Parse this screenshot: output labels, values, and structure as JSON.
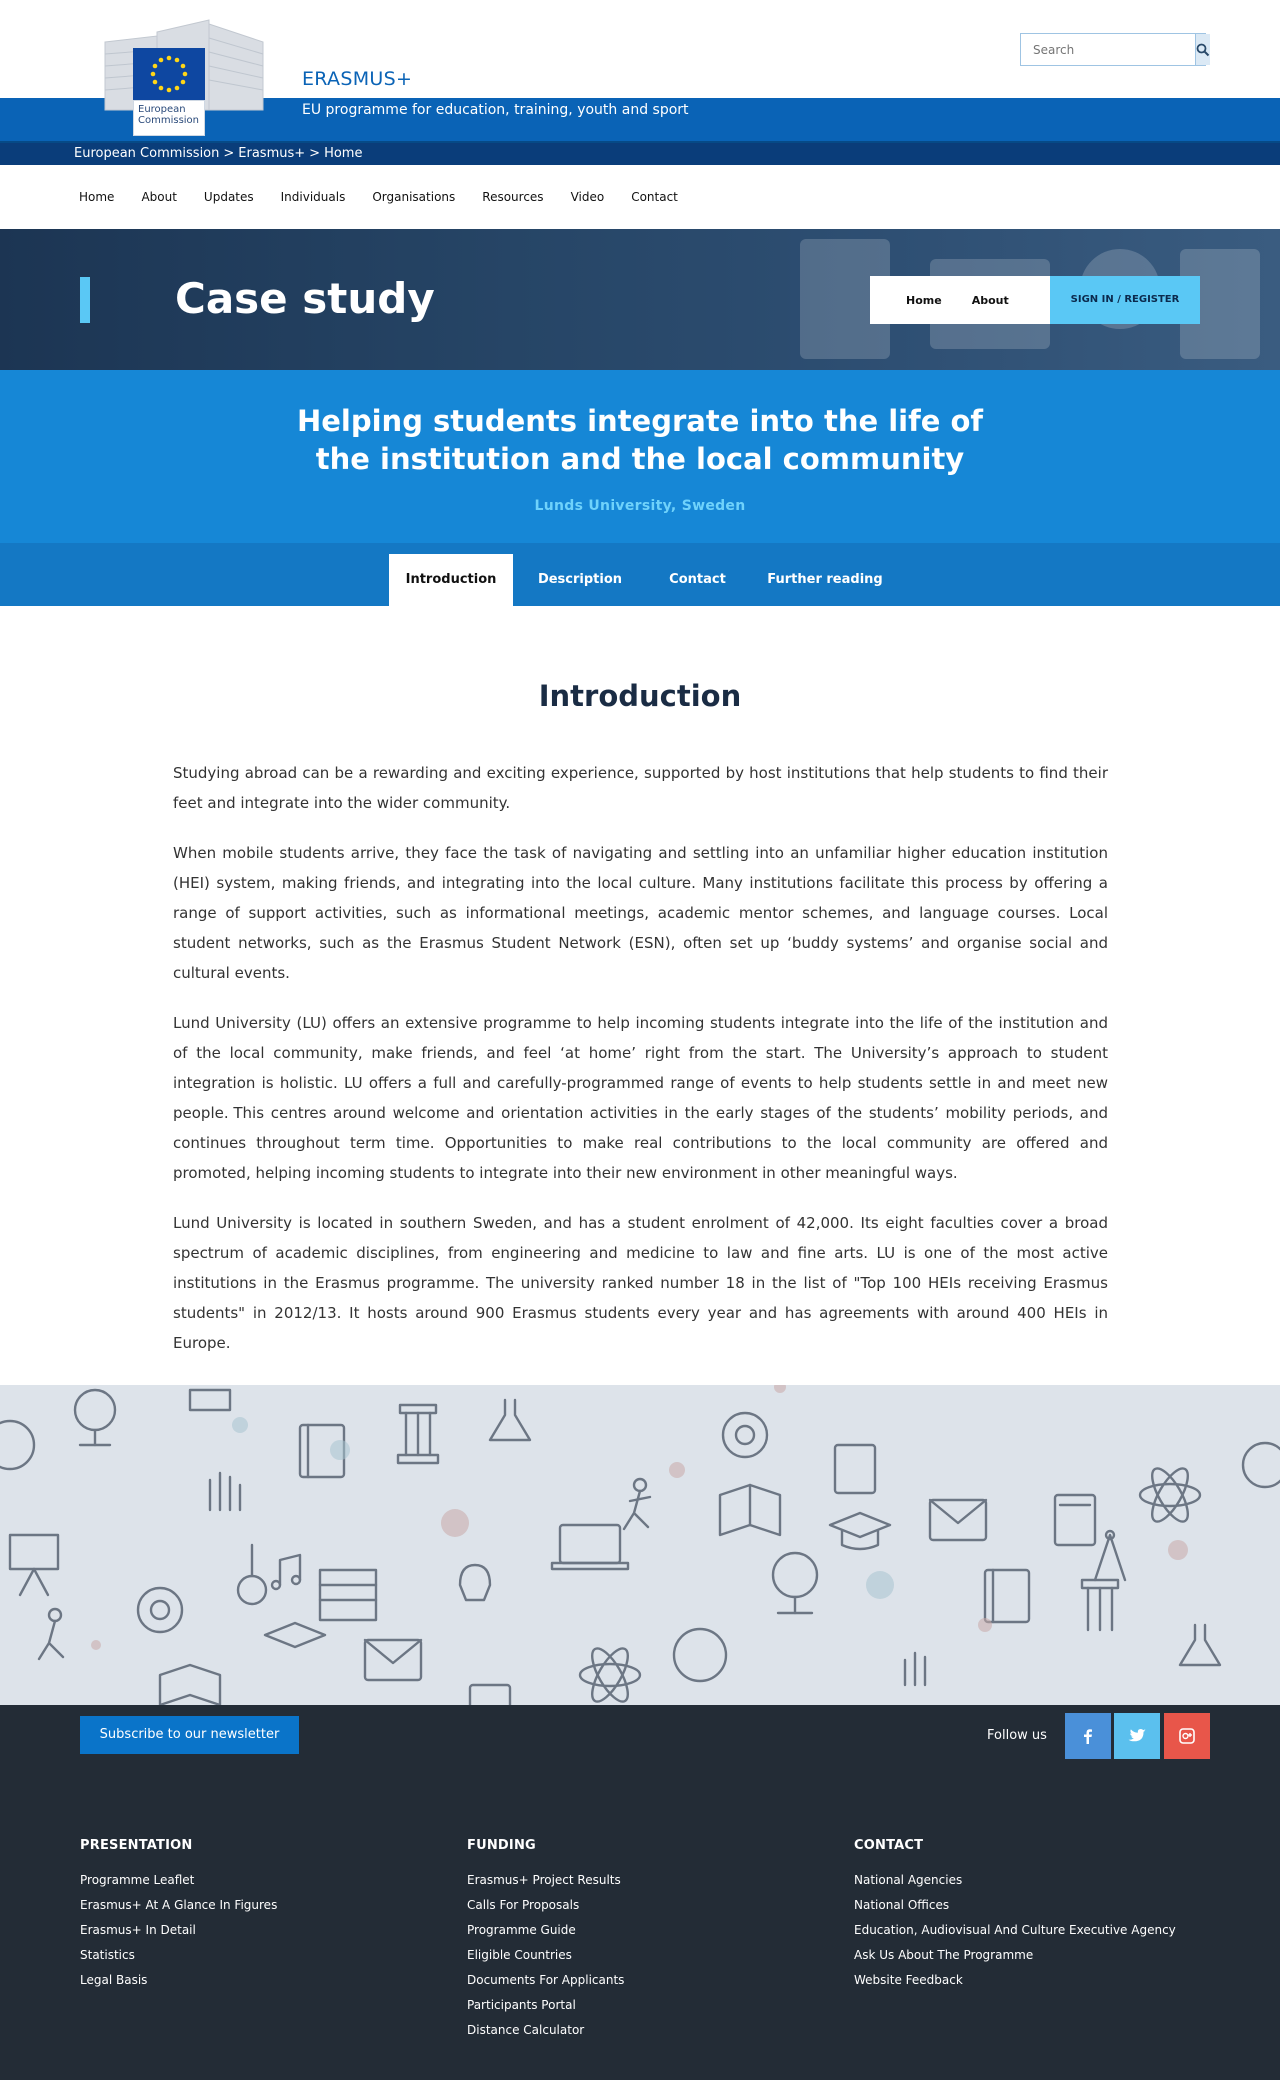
{
  "header": {
    "logo_text": "European Commission",
    "brand": "ERASMUS+",
    "tagline": "EU programme for education, training, youth and sport",
    "search_placeholder": "Search"
  },
  "breadcrumb": {
    "items": [
      "European Commission",
      "Erasmus+",
      "Home"
    ],
    "separator": ">"
  },
  "nav": {
    "items": [
      "Home",
      "About",
      "Updates",
      "Individuals",
      "Organisations",
      "Resources",
      "Video",
      "Contact"
    ]
  },
  "hero": {
    "title": "Case study",
    "box_links": [
      "Home",
      "About"
    ],
    "signin": "SIGN IN / REGISTER"
  },
  "case": {
    "title_line1": "Helping students integrate into the life of",
    "title_line2": "the institution and the local community",
    "subtitle": "Lunds University, Sweden"
  },
  "tabs": {
    "items": [
      "Introduction",
      "Description",
      "Contact",
      "Further reading"
    ],
    "active": "Introduction"
  },
  "content": {
    "heading": "Introduction",
    "paragraphs": [
      "Studying abroad can be a rewarding and exciting experience, supported by host institutions that help students to find their feet and integrate into the wider community.",
      "When mobile students arrive, they face the task of navigating and settling into an unfamiliar higher education institution (HEI) system, making friends, and integrating into the local culture. Many institutions facilitate this process by offering a range of support activities, such as informational meetings, academic mentor schemes, and language courses. Local student networks, such as the Erasmus Student Network (ESN), often set up ‘buddy systems’ and organise social and cultural events.",
      "Lund University (LU) offers an extensive programme to help incoming students integrate into the life of the institution and of the local community, make friends, and feel ‘at home’ right from the start. The University’s approach to student integration is holistic. LU offers a full and carefully-programmed range of events to help students settle in and meet new people. This centres around welcome and orientation activities in the early stages of the students’ mobility periods, and continues throughout term time. Opportunities to make real contributions to the local community are offered and promoted, helping incoming students to integrate into their new environment in other meaningful ways.",
      "Lund University is located in southern Sweden, and has a student enrolment of 42,000. Its eight faculties cover a broad spectrum of academic disciplines, from engineering and medicine to law and fine arts. LU is one of the most active institutions in the Erasmus programme. The university ranked number 18 in the list of \"Top 100 HEIs receiving Erasmus students\" in 2012/13. It hosts around 900 Erasmus students every year and has agreements with around 400 HEIs in Europe."
    ]
  },
  "footer": {
    "newsletter": "Subscribe to our newsletter",
    "follow": "Follow us",
    "social_icons": [
      "facebook-icon",
      "twitter-icon",
      "google-plus-icon"
    ],
    "colors": {
      "facebook": "#4a90d9",
      "twitter": "#5bc0ee",
      "googleplus": "#e8564a"
    },
    "columns": [
      {
        "title": "PRESENTATION",
        "links": [
          "Programme Leaflet",
          "Erasmus+ At A Glance In Figures",
          "Erasmus+ In Detail",
          "Statistics",
          "Legal Basis"
        ]
      },
      {
        "title": "FUNDING",
        "links": [
          "Erasmus+ Project Results",
          "Calls For Proposals",
          "Programme Guide",
          "Eligible Countries",
          "Documents For Applicants",
          "Participants Portal",
          "Distance Calculator"
        ]
      },
      {
        "title": "CONTACT",
        "links": [
          "National Agencies",
          "National Offices",
          "Education, Audiovisual And Culture Executive Agency",
          "Ask Us About The Programme",
          "Website Feedback"
        ]
      }
    ]
  }
}
